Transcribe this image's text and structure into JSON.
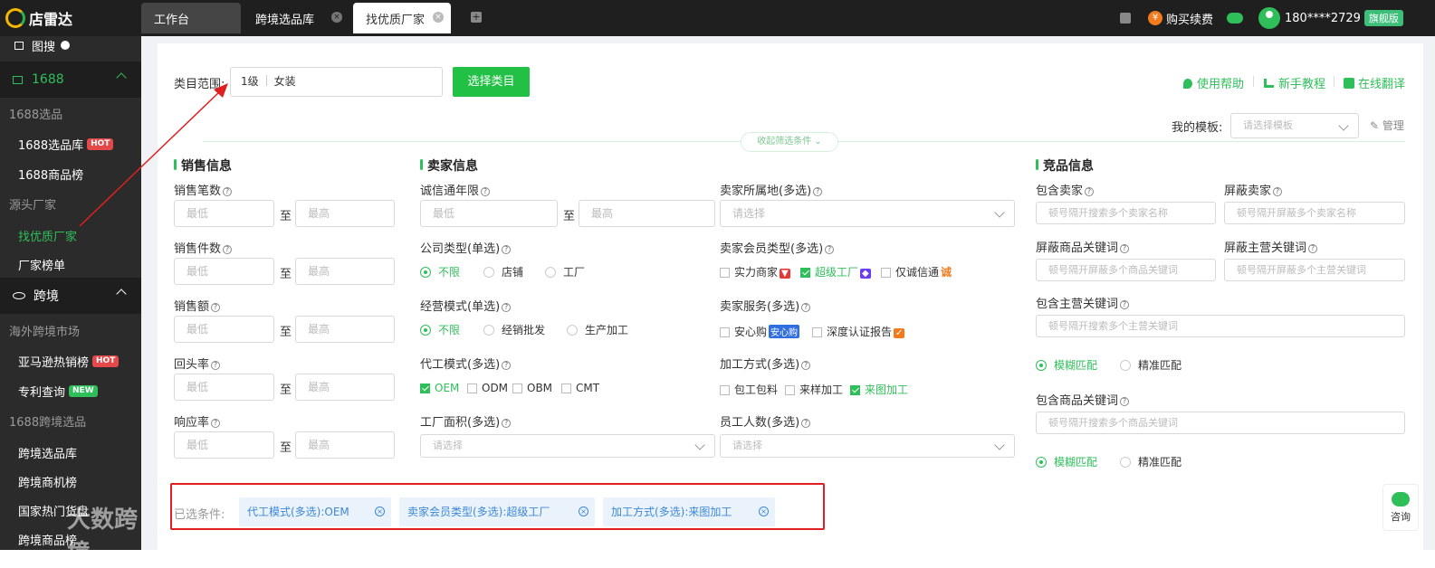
{
  "app": {
    "name": "店雷达"
  },
  "tabs": [
    {
      "label": "工作台"
    },
    {
      "label": "跨境选品库"
    },
    {
      "label": "找优质厂家"
    }
  ],
  "topright": {
    "renew": "购买续费",
    "coin": "¥",
    "user": "180****2729",
    "vip": "旗舰版"
  },
  "sidebar": {
    "image_search": "图搜",
    "group1688": "1688",
    "sec1": "1688选品",
    "lib": "1688选品库",
    "hot": "HOT",
    "rank": "1688商品榜",
    "sec2": "源头厂家",
    "find": "找优质厂家",
    "factory_rank": "厂家榜单",
    "cross": "跨境",
    "sec3": "海外跨境市场",
    "amazon": "亚马逊热销榜",
    "patent": "专利查询",
    "new": "NEW",
    "sec4": "1688跨境选品",
    "cross_lib": "跨境选品库",
    "cross_opp": "跨境商机榜",
    "goods": "国家热门货盘",
    "cross_goods": "跨境商品榜",
    "watermark": "大数跨境"
  },
  "header": {
    "range_label": "类目范围:",
    "level": "1级",
    "category": "女装",
    "select_btn": "选择类目",
    "help": "使用帮助",
    "tutorial": "新手教程",
    "translate": "在线翻译",
    "template_label": "我的模板:",
    "template_placeholder": "请选择模板",
    "manage": "管理",
    "collapse": "收起筛选条件"
  },
  "placeholders": {
    "min": "最低",
    "max": "最高",
    "select": "请选择",
    "to": "至",
    "seller_search": "顿号隔开搜索多个卖家名称",
    "seller_block": "顿号隔开屏蔽多个卖家名称",
    "prod_block": "顿号隔开屏蔽多个商品关键词",
    "main_block": "顿号隔开屏蔽多个主营关键词",
    "main_search": "顿号隔开搜索多个主营关键词",
    "prod_search": "顿号隔开搜索多个商品关键词"
  },
  "sales": {
    "title": "销售信息",
    "fields": [
      "销售笔数",
      "销售件数",
      "销售额",
      "回头率",
      "响应率"
    ]
  },
  "seller": {
    "title": "卖家信息",
    "years": "诚信通年限",
    "region": "卖家所属地(多选)",
    "company_type": "公司类型(单选)",
    "company_opts": [
      "不限",
      "店铺",
      "工厂"
    ],
    "member_type": "卖家会员类型(多选)",
    "member_opts": [
      "实力商家",
      "超级工厂",
      "仅诚信通"
    ],
    "biz_mode": "经营模式(单选)",
    "biz_opts": [
      "不限",
      "经销批发",
      "生产加工"
    ],
    "service": "卖家服务(多选)",
    "service_opts": [
      "安心购",
      "深度认证报告"
    ],
    "anxin_tag": "安心购",
    "oem_mode": "代工模式(多选)",
    "oem_opts": [
      "OEM",
      "ODM",
      "OBM",
      "CMT"
    ],
    "process": "加工方式(多选)",
    "process_opts": [
      "包工包料",
      "来样加工",
      "来图加工"
    ],
    "area": "工厂面积(多选)",
    "staff": "员工人数(多选)"
  },
  "competitor": {
    "title": "竞品信息",
    "include_seller": "包含卖家",
    "block_seller": "屏蔽卖家",
    "block_prod": "屏蔽商品关键词",
    "block_main": "屏蔽主营关键词",
    "include_main": "包含主营关键词",
    "fuzzy": "模糊匹配",
    "exact": "精准匹配",
    "include_prod": "包含商品关键词"
  },
  "selected": {
    "label": "已选条件:",
    "chips": [
      "代工模式(多选):OEM",
      "卖家会员类型(多选):超级工厂",
      "加工方式(多选):来图加工"
    ]
  },
  "consult": "咨询",
  "colors": {
    "green": "#22c145",
    "dark": "#1f1f1f",
    "annotation": "#e02020"
  }
}
